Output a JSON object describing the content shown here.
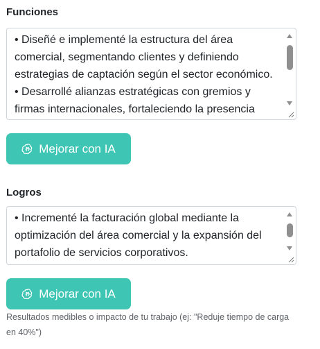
{
  "funciones": {
    "label": "Funciones",
    "text": "• Diseñé e implementé la estructura del área comercial, segmentando clientes y definiendo estrategias de captación según el sector económico.\n• Desarrollé alianzas estratégicas con gremios y firmas internacionales, fortaleciendo la presencia",
    "button_label": "Mejorar con IA"
  },
  "logros": {
    "label": "Logros",
    "text": "• Incrementé la facturación global mediante la optimización del área comercial y la expansión del portafolio de servicios corporativos.",
    "button_label": "Mejorar con IA",
    "hint": "Resultados medibles o impacto de tu trabajo (ej: \"Reduje tiempo de carga en 40%\")"
  },
  "colors": {
    "accent": "#3fc5b3",
    "border": "#ced4da"
  },
  "icons": {
    "button_icon": "openai-icon"
  }
}
